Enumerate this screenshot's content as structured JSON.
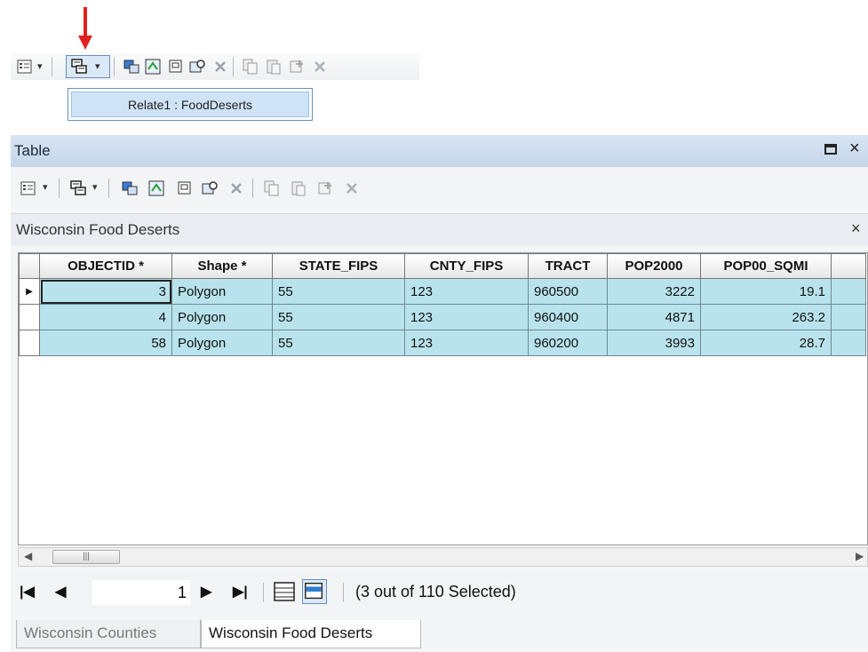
{
  "relate_menu": {
    "item_label": "Relate1 : FoodDeserts"
  },
  "table_window": {
    "title": "Table",
    "active_table_name": "Wisconsin Food Deserts",
    "close_glyph": "×"
  },
  "grid": {
    "columns": [
      "OBJECTID *",
      "Shape *",
      "STATE_FIPS",
      "CNTY_FIPS",
      "TRACT",
      "POP2000",
      "POP00_SQMI"
    ],
    "rows": [
      {
        "objectid": "3",
        "shape": "Polygon",
        "state_fips": "55",
        "cnty_fips": "123",
        "tract": "960500",
        "pop2000": "3222",
        "pop00_sqmi": "19.1"
      },
      {
        "objectid": "4",
        "shape": "Polygon",
        "state_fips": "55",
        "cnty_fips": "123",
        "tract": "960400",
        "pop2000": "4871",
        "pop00_sqmi": "263.2"
      },
      {
        "objectid": "58",
        "shape": "Polygon",
        "state_fips": "55",
        "cnty_fips": "123",
        "tract": "960200",
        "pop2000": "3993",
        "pop00_sqmi": "28.7"
      }
    ]
  },
  "navigation": {
    "current_record": "1",
    "selection_status": "(3 out of 110 Selected)"
  },
  "bottom_tabs": [
    {
      "label": "Wisconsin Counties",
      "active": false
    },
    {
      "label": "Wisconsin Food Deserts",
      "active": true
    }
  ],
  "colors": {
    "highlight_arrow": "#e02020",
    "selected_row": "#b9e3ec",
    "title_bar": "#c4d6ea"
  },
  "icons": [
    "table-options-icon",
    "related-tables-icon",
    "select-by-attributes-icon",
    "switch-selection-icon",
    "clear-selection-icon",
    "zoom-to-selected-icon",
    "delete-selected-icon",
    "copy-selected-icon",
    "paste-icon",
    "add-field-icon",
    "delete-icon"
  ]
}
